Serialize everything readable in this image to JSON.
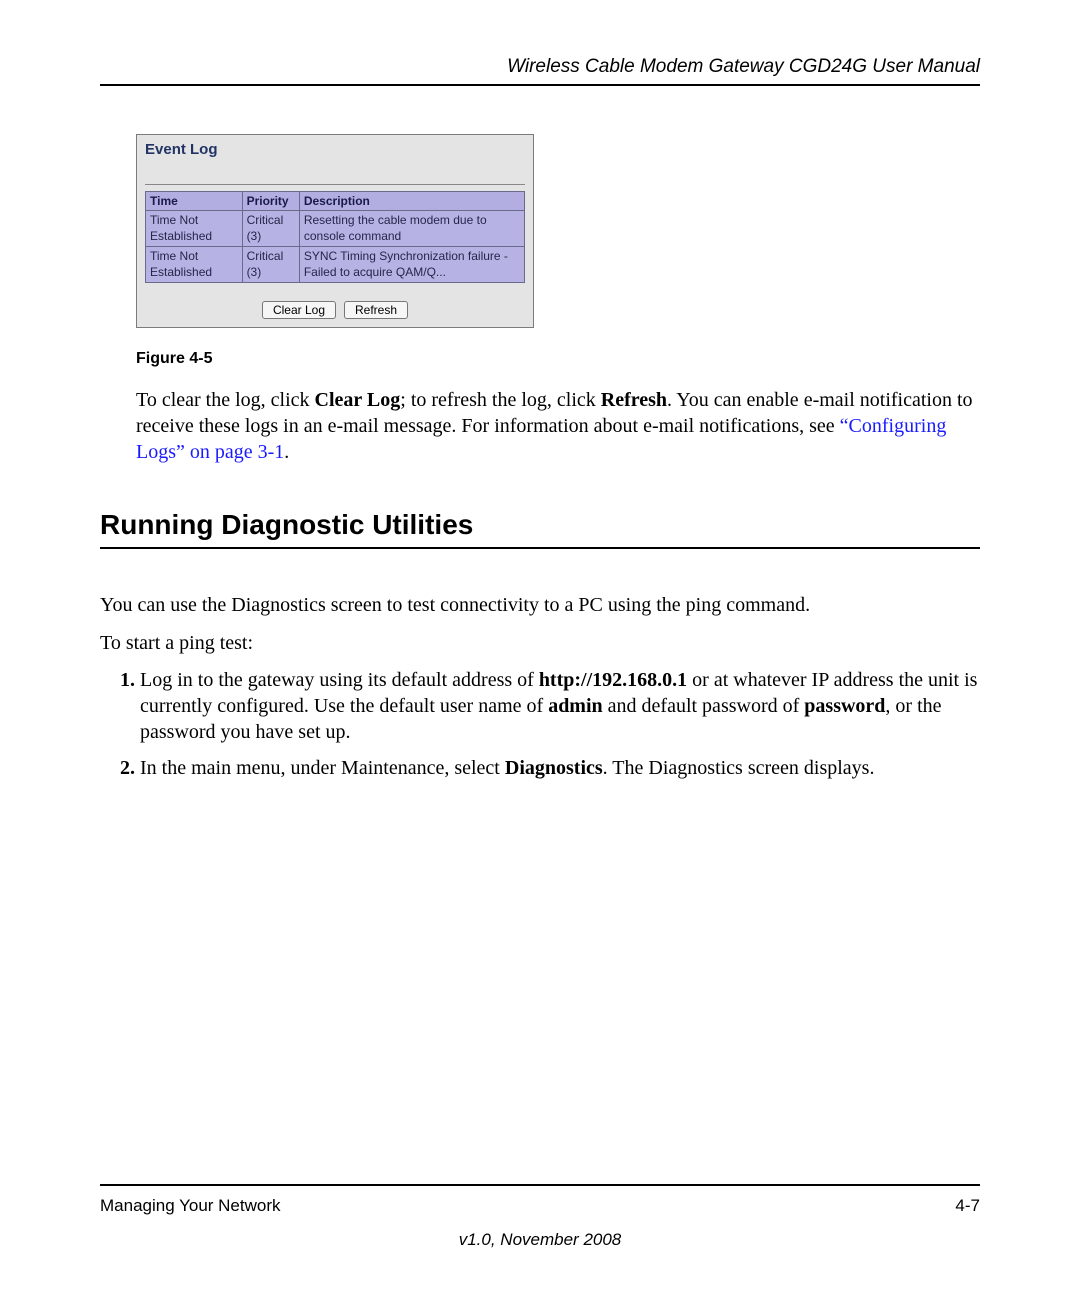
{
  "header": {
    "title": "Wireless Cable Modem Gateway CGD24G User Manual"
  },
  "eventlog": {
    "title": "Event Log",
    "columns": {
      "c0": "Time",
      "c1": "Priority",
      "c2": "Description"
    },
    "rows": {
      "r0": {
        "c0": "Time Not Established",
        "c1": "Critical (3)",
        "c2": "Resetting the cable modem due to console command"
      },
      "r1": {
        "c0": "Time Not Established",
        "c1": "Critical (3)",
        "c2": "SYNC Timing Synchronization failure - Failed to acquire QAM/Q..."
      }
    },
    "buttons": {
      "clear": "Clear Log",
      "refresh": "Refresh"
    }
  },
  "figure_caption": "Figure 4-5",
  "para1": {
    "seg0": "To clear the log, click ",
    "b0": "Clear Log",
    "seg1": "; to refresh the log, click ",
    "b1": "Refresh",
    "seg2": ". You can enable e-mail notification to receive these logs in an e-mail message. For information about e-mail notifications, see ",
    "link": "“Configuring Logs” on page 3-1",
    "seg3": "."
  },
  "section_heading": "Running Diagnostic Utilities",
  "intro1": "You can use the Diagnostics screen to test connectivity to a PC using the ping command.",
  "intro2": "To start a ping test:",
  "steps": {
    "s1": {
      "seg0": "Log in to the gateway using its default address of ",
      "b0": "http://192.168.0.1",
      "seg1": " or at whatever IP address the unit is currently configured. Use the default user name of ",
      "b1": "admin",
      "seg2": " and default password of ",
      "b2": "password",
      "seg3": ", or the password you have set up."
    },
    "s2": {
      "seg0": "In the main menu, under Maintenance, select ",
      "b0": "Diagnostics",
      "seg1": ". The Diagnostics screen displays."
    }
  },
  "footer": {
    "left": "Managing Your Network",
    "right": "4-7",
    "version": "v1.0, November 2008"
  }
}
